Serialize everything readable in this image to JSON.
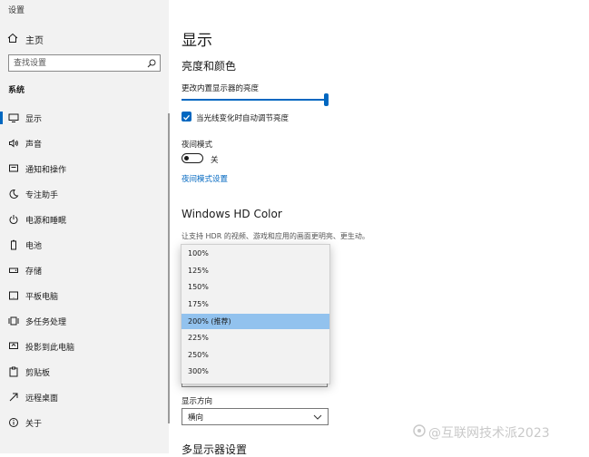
{
  "window": {
    "title": "设置"
  },
  "sidebar": {
    "home_label": "主页",
    "search_placeholder": "查找设置",
    "section_title": "系统",
    "items": [
      {
        "label": "显示",
        "icon": "monitor-icon",
        "active": true
      },
      {
        "label": "声音",
        "icon": "speaker-icon"
      },
      {
        "label": "通知和操作",
        "icon": "notification-icon"
      },
      {
        "label": "专注助手",
        "icon": "moon-icon"
      },
      {
        "label": "电源和睡眠",
        "icon": "power-icon"
      },
      {
        "label": "电池",
        "icon": "battery-icon"
      },
      {
        "label": "存储",
        "icon": "storage-icon"
      },
      {
        "label": "平板电脑",
        "icon": "tablet-icon"
      },
      {
        "label": "多任务处理",
        "icon": "multitask-icon"
      },
      {
        "label": "投影到此电脑",
        "icon": "project-icon"
      },
      {
        "label": "剪贴板",
        "icon": "clipboard-icon"
      },
      {
        "label": "远程桌面",
        "icon": "remote-desktop-icon"
      },
      {
        "label": "关于",
        "icon": "info-icon"
      }
    ]
  },
  "main": {
    "page_title": "显示",
    "brightness_heading": "亮度和颜色",
    "brightness_label": "更改内置显示器的亮度",
    "brightness_value": 100,
    "auto_brightness_label": "当光线变化时自动调节亮度",
    "auto_brightness_checked": true,
    "night_mode_label": "夜间模式",
    "night_mode_state": "关",
    "night_mode_settings_link": "夜间模式设置",
    "hdr_heading": "Windows HD Color",
    "hdr_description": "让支持 HDR 的视频、游戏和应用的画面更明亮、更生动。",
    "scale_options": [
      "100%",
      "125%",
      "150%",
      "175%",
      "200% (推荐)",
      "225%",
      "250%",
      "300%"
    ],
    "scale_selected_index": 4,
    "orientation_label": "显示方向",
    "orientation_value": "横向",
    "multi_display_heading": "多显示器设置"
  },
  "watermark": {
    "text": "@互联网技术派2023"
  },
  "colors": {
    "accent": "#0067c0",
    "selected_option": "#92c2ee",
    "sidebar_bg": "#f2f2f2"
  }
}
